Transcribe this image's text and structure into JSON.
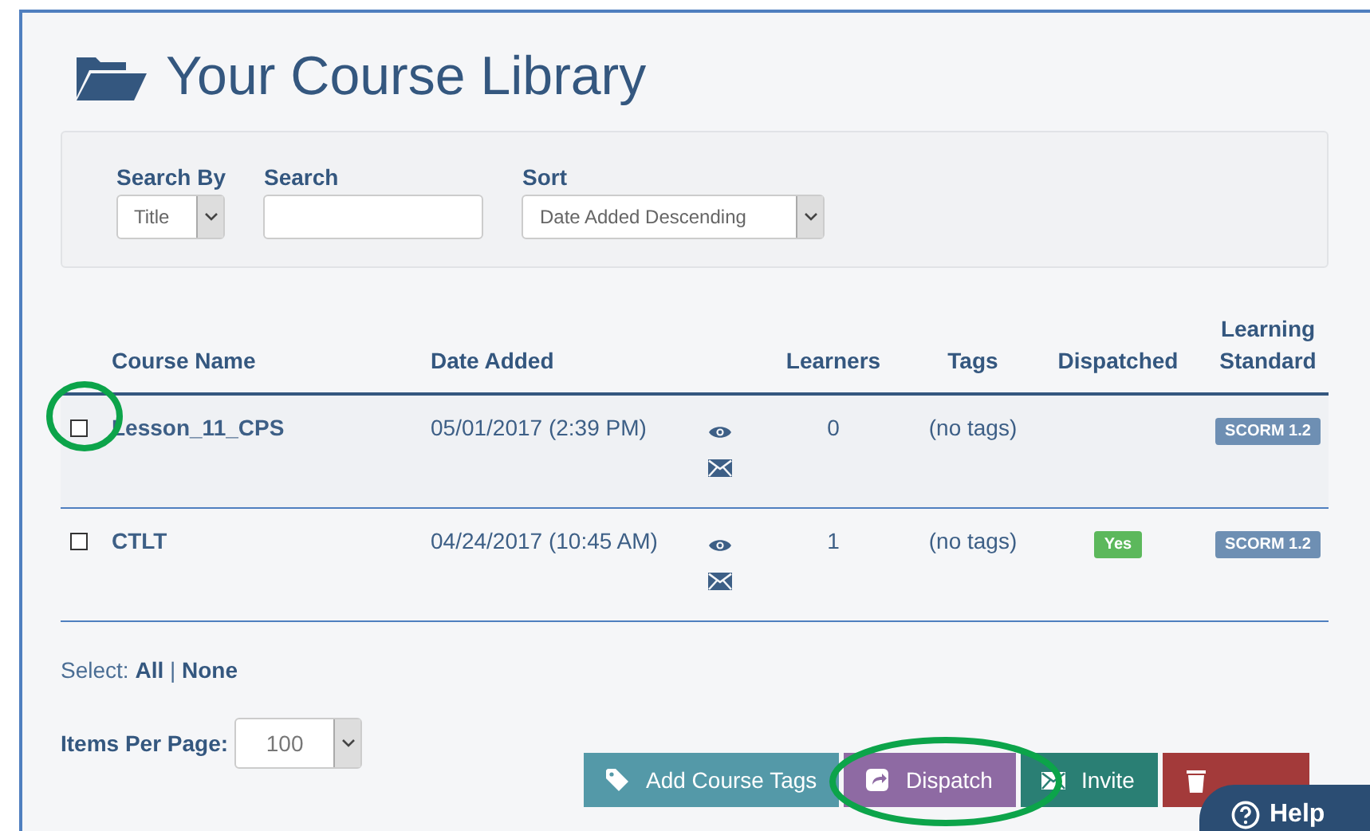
{
  "title": "Your Course Library",
  "filters": {
    "search_by": {
      "label": "Search By",
      "value": "Title"
    },
    "search": {
      "label": "Search"
    },
    "sort": {
      "label": "Sort",
      "value": "Date Added Descending"
    }
  },
  "table": {
    "columns": [
      "Course Name",
      "Date Added",
      "Learners",
      "Tags",
      "Dispatched",
      "Learning Standard"
    ],
    "rows": [
      {
        "checked": false,
        "name": "Lesson_11_CPS",
        "date": "05/01/2017 (2:39 PM)",
        "learners": "0",
        "tags": "(no tags)",
        "standard": "SCORM 1.2"
      },
      {
        "checked": false,
        "name": "CTLT",
        "date": "04/24/2017 (10:45 AM)",
        "learners": "1",
        "tags": "(no tags)",
        "dispatched": "Yes",
        "standard": "SCORM 1.2"
      }
    ]
  },
  "select": {
    "label": "Select:",
    "all": "All",
    "separator": "|",
    "none": "None"
  },
  "items_per_page": {
    "label": "Items Per Page:",
    "value": "100"
  },
  "actions": [
    {
      "kind": "tags",
      "label": "Add Course Tags"
    },
    {
      "kind": "dispatch",
      "label": "Dispatch"
    },
    {
      "kind": "invite",
      "label": "Invite"
    },
    {
      "kind": "delete"
    }
  ],
  "help": {
    "label": "Help"
  }
}
